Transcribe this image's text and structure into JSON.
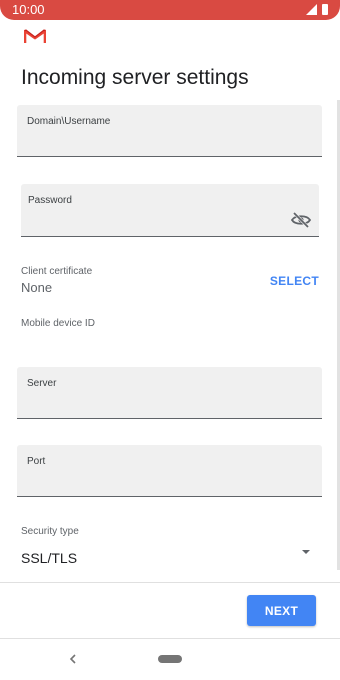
{
  "status_bar": {
    "time": "10:00",
    "background_color": "#d94a42",
    "icons": [
      "signal-icon",
      "battery-icon"
    ]
  },
  "header": {
    "logo": "gmail-logo",
    "title": "Incoming server settings"
  },
  "form": {
    "domain_username": {
      "label": "Domain\\Username",
      "value": ""
    },
    "password": {
      "label": "Password",
      "value": "",
      "visibility_icon": "eye-off-icon"
    },
    "client_certificate": {
      "label": "Client certificate",
      "value": "None",
      "action_label": "SELECT"
    },
    "mobile_device_id": {
      "label": "Mobile device ID",
      "value": ""
    },
    "server": {
      "label": "Server",
      "value": ""
    },
    "port": {
      "label": "Port",
      "value": ""
    },
    "security_type": {
      "label": "Security type",
      "selected": "SSL/TLS",
      "icon": "dropdown-arrow-icon"
    }
  },
  "footer": {
    "next_label": "NEXT",
    "accent_color": "#4285f4"
  },
  "nav_bar": {
    "icons": [
      "back-icon",
      "home-pill"
    ]
  }
}
